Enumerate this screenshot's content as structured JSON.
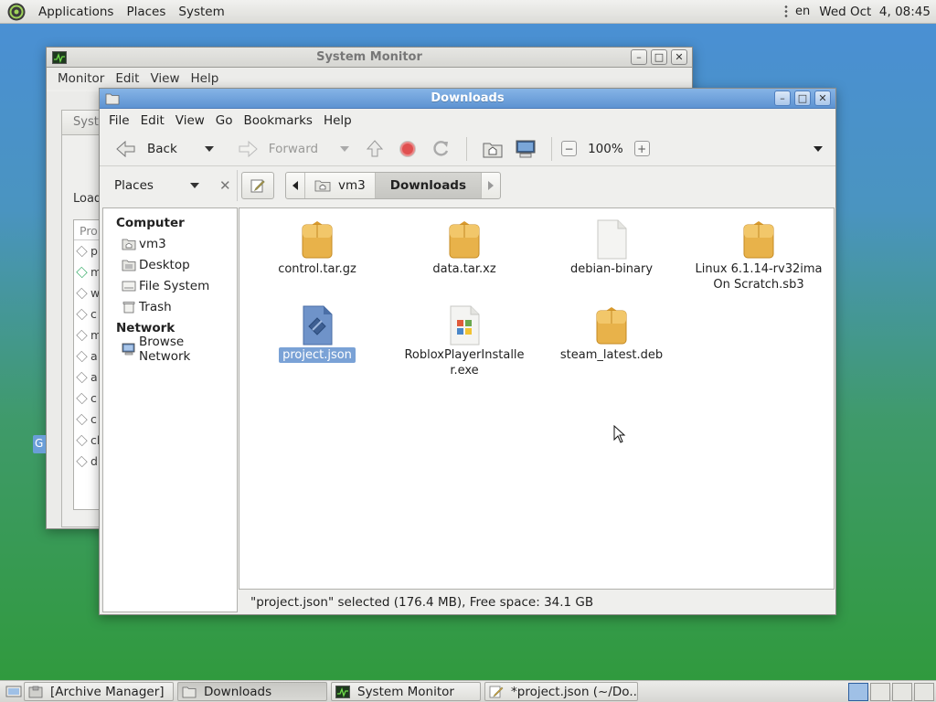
{
  "top_panel": {
    "menus": [
      "Applications",
      "Places",
      "System"
    ],
    "lang": "en",
    "clock": "Wed Oct  4, 08:45"
  },
  "system_monitor": {
    "title": "System Monitor",
    "menus": [
      "Monitor",
      "Edit",
      "View",
      "Help"
    ],
    "tab_fragment": "Syste",
    "load_fragment": "Load",
    "list_header_fragment": "Pro",
    "row_fragments": [
      "p",
      "m",
      "w",
      "c",
      "m",
      "a",
      "a",
      "c",
      "c",
      "cl",
      "d"
    ],
    "side_badge": "G"
  },
  "downloads": {
    "title": "Downloads",
    "menus": [
      "File",
      "Edit",
      "View",
      "Go",
      "Bookmarks",
      "Help"
    ],
    "toolbar": {
      "back_label": "Back",
      "forward_label": "Forward",
      "zoom": "100%"
    },
    "places_label": "Places",
    "breadcrumb": [
      "vm3",
      "Downloads"
    ],
    "sidebar": {
      "computer_heading": "Computer",
      "computer_items": [
        "vm3",
        "Desktop",
        "File System",
        "Trash"
      ],
      "network_heading": "Network",
      "network_items": [
        "Browse Network"
      ]
    },
    "files": [
      {
        "name": "control.tar.gz",
        "type": "archive"
      },
      {
        "name": "data.tar.xz",
        "type": "archive"
      },
      {
        "name": "debian-binary",
        "type": "blank"
      },
      {
        "name": "Linux 6.1.14-rv32ima On Scratch.sb3",
        "type": "archive"
      },
      {
        "name": "project.json",
        "type": "json",
        "selected": true
      },
      {
        "name": "RobloxPlayerInstaller.exe",
        "type": "exe"
      },
      {
        "name": "steam_latest.deb",
        "type": "archive"
      }
    ],
    "status": "\"project.json\" selected (176.4 MB), Free space: 34.1 GB"
  },
  "taskbar": {
    "tasks": [
      {
        "label": "[Archive Manager]",
        "icon": "archive-manager-icon"
      },
      {
        "label": "Downloads",
        "icon": "folder-icon",
        "active": true
      },
      {
        "label": "System Monitor",
        "icon": "system-monitor-icon"
      },
      {
        "label": "*project.json (~/Do...",
        "icon": "text-editor-icon"
      }
    ],
    "workspaces": 4
  },
  "colors": {
    "title_active": "#5d93d2",
    "selection": "#7aa2d6",
    "folder": "#e8b24a"
  }
}
